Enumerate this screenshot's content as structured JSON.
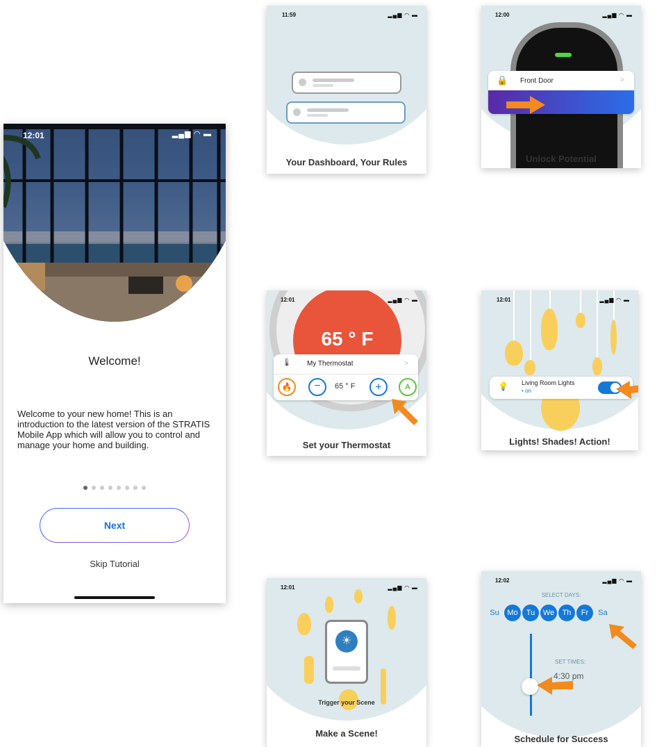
{
  "main": {
    "status_time": "12:01",
    "status_icons": "▂▄▆ ◠ ▬",
    "title": "Welcome!",
    "intro": "Welcome to your new home! This is an introduction to the latest version of the STRATIS Mobile App which will allow you to control and manage your home and building.",
    "page_count": 8,
    "current_page": 1,
    "next_label": "Next",
    "skip_label": "Skip Tutorial"
  },
  "dashboard": {
    "status_time": "11:59",
    "status_icons": "▂▄▆ ◠ ▬",
    "caption": "Your Dashboard, Your Rules"
  },
  "unlock": {
    "status_time": "12:00",
    "status_icons": "▂▄▆ ◠ ▬",
    "lock_name": "Front Door",
    "chevron": ">",
    "caption": "Unlock Potential"
  },
  "thermostat": {
    "status_time": "12:01",
    "status_icons": "▂▄▆ ◠ ▬",
    "big_temp": "65 ° F",
    "device_name": "My Thermostat",
    "chevron": ">",
    "minus": "−",
    "setpoint": "65 ° F",
    "plus": "+",
    "auto": "A",
    "caption": "Set your Thermostat"
  },
  "lights": {
    "status_time": "12:01",
    "status_icons": "▂▄▆ ◠ ▬",
    "device_name": "Living Room Lights",
    "state": "• on",
    "caption": "Lights! Shades! Action!"
  },
  "scene": {
    "status_time": "12:01",
    "status_icons": "▂▄▆ ◠ ▬",
    "trigger_label": "Trigger your Scene",
    "caption": "Make a Scene!"
  },
  "schedule": {
    "status_time": "12:02",
    "status_icons": "▂▄▆ ◠ ▬",
    "select_days_label": "SELECT DAYS:",
    "days": [
      {
        "label": "Su",
        "selected": false
      },
      {
        "label": "Mo",
        "selected": true
      },
      {
        "label": "Tu",
        "selected": true
      },
      {
        "label": "We",
        "selected": true
      },
      {
        "label": "Th",
        "selected": true
      },
      {
        "label": "Fr",
        "selected": true
      },
      {
        "label": "Sa",
        "selected": false
      }
    ],
    "set_times_label": "SET TIMES:",
    "time_value": "4:30 pm",
    "caption": "Schedule for Success"
  },
  "colors": {
    "accent_blue": "#1478d8",
    "arrow_orange": "#f28a1e",
    "thermo_red": "#e9553a",
    "bulb_yellow": "#f9cf5c",
    "arc_bg": "#dde9ec"
  }
}
